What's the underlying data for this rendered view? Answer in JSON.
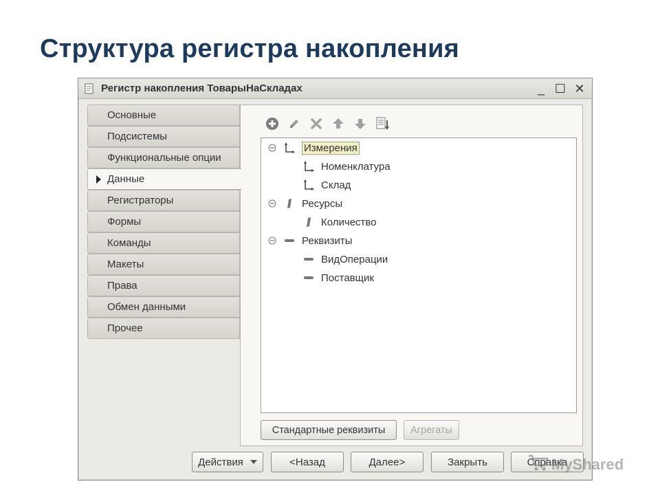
{
  "slide": {
    "title": "Структура регистра накопления"
  },
  "window": {
    "title": "Регистр накопления ТоварыНаСкладах",
    "controls": {
      "minimize": "_",
      "maximize": "☐",
      "close": "✕"
    }
  },
  "nav": {
    "items": [
      {
        "label": "Основные"
      },
      {
        "label": "Подсистемы"
      },
      {
        "label": "Функциональные опции"
      },
      {
        "label": "Данные"
      },
      {
        "label": "Регистраторы"
      },
      {
        "label": "Формы"
      },
      {
        "label": "Команды"
      },
      {
        "label": "Макеты"
      },
      {
        "label": "Права"
      },
      {
        "label": "Обмен данными"
      },
      {
        "label": "Прочее"
      }
    ],
    "active_label": "Данные"
  },
  "toolbar": {
    "icons": [
      "add-icon",
      "edit-pencil-icon",
      "delete-icon",
      "move-up-icon",
      "move-down-icon",
      "sort-list-icon"
    ]
  },
  "tree": {
    "rows": [
      {
        "label": "Измерения",
        "level": 0,
        "kind": "dimension",
        "expanded": true,
        "selected": true
      },
      {
        "label": "Номенклатура",
        "level": 1,
        "kind": "dimension"
      },
      {
        "label": "Склад",
        "level": 1,
        "kind": "dimension"
      },
      {
        "label": "Ресурсы",
        "level": 0,
        "kind": "resource",
        "expanded": true
      },
      {
        "label": "Количество",
        "level": 1,
        "kind": "resource"
      },
      {
        "label": "Реквизиты",
        "level": 0,
        "kind": "attribute",
        "expanded": true
      },
      {
        "label": "ВидОперации",
        "level": 1,
        "kind": "attribute"
      },
      {
        "label": "Поставщик",
        "level": 1,
        "kind": "attribute"
      }
    ]
  },
  "panel_buttons": {
    "standard": "Стандартные реквизиты",
    "aggregates": "Агрегаты"
  },
  "footer_buttons": {
    "actions": "Действия",
    "back": "<Назад",
    "next": "Далее>",
    "close": "Закрыть",
    "help": "Справка"
  },
  "watermark": {
    "text": "MyShared"
  },
  "colors": {
    "title": "#1f3b5c",
    "accent_green": "#2e8b3a"
  }
}
